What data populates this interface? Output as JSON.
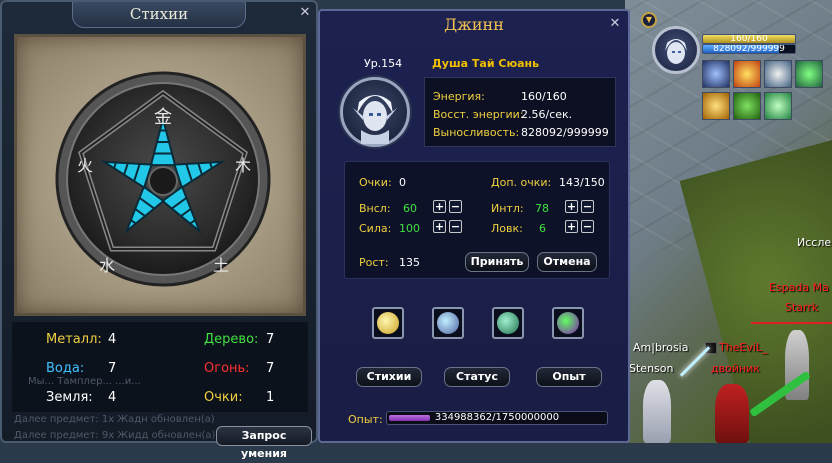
{
  "elements_panel": {
    "title": "Стихии",
    "metal_label": "Металл:",
    "metal_value": "4",
    "wood_label": "Дерево:",
    "wood_value": "7",
    "water_label": "Вода:",
    "water_value": "7",
    "fire_label": "Огонь:",
    "fire_value": "7",
    "earth_label": "Земля:",
    "earth_value": "4",
    "points_label": "Очки:",
    "points_value": "1",
    "query_button": "Запрос умения",
    "chat_ghost_1": "Мы... Тамплер... ...и...",
    "chat_ghost_2": "Далее предмет: 1х Жадный...",
    "chat_ghost_3": "Далее предмет: 1х Жадн обновлен(а)",
    "chat_ghost_4": "Далее предмет: 9х Жидд обновлен(а)",
    "colors": {
      "metal": "#f0d040",
      "wood": "#40e040",
      "water": "#40c0ff",
      "fire": "#ff3030",
      "earth": "#ffffff",
      "points": "#f0d040"
    }
  },
  "genie_panel": {
    "title": "Джинн",
    "level": "Ур.154",
    "name": "Душа Тай Сюань",
    "energy_label": "Энергия:",
    "energy_value": "160/160",
    "regen_label": "Восст. энергии:",
    "regen_value": "2.56/сек.",
    "stamina_label": "Выносливость:",
    "stamina_value": "828092/999999",
    "points_label": "Очки:",
    "points_value": "0",
    "extra_points_label": "Доп. очки:",
    "extra_points_value": "143/150",
    "vnsl_label": "Внсл:",
    "vnsl_value": "60",
    "str_label": "Сила:",
    "str_value": "100",
    "int_label": "Интл:",
    "int_value": "78",
    "dex_label": "Ловк:",
    "dex_value": "6",
    "growth_label": "Рост:",
    "growth_value": "135",
    "plus": "+",
    "minus": "−",
    "accept_button": "Принять",
    "cancel_button": "Отмена",
    "elements_button": "Стихии",
    "status_button": "Статус",
    "exp_button": "Опыт",
    "exp_label": "Опыт:",
    "exp_value": "334988362/1750000000",
    "exp_fraction": 0.19
  },
  "hud": {
    "hp_text": "160/160",
    "mp_text": "828092/999999",
    "hp_fraction": 1.0,
    "mp_fraction": 0.83,
    "arrow_glyph": "▼"
  },
  "world": {
    "names": [
      {
        "text": "Иссле",
        "color": "#ffffff"
      },
      {
        "text": "Espada Ma",
        "color": "#ff2020"
      },
      {
        "text": "Starrk",
        "color": "#ff2020"
      },
      {
        "text": "Am|brosia",
        "color": "#ffffff"
      },
      {
        "text": "Stenson",
        "color": "#ffffff"
      },
      {
        "text": "TheEviL_",
        "color": "#ff2020"
      },
      {
        "text": "двойник",
        "color": "#ff2020"
      }
    ]
  }
}
